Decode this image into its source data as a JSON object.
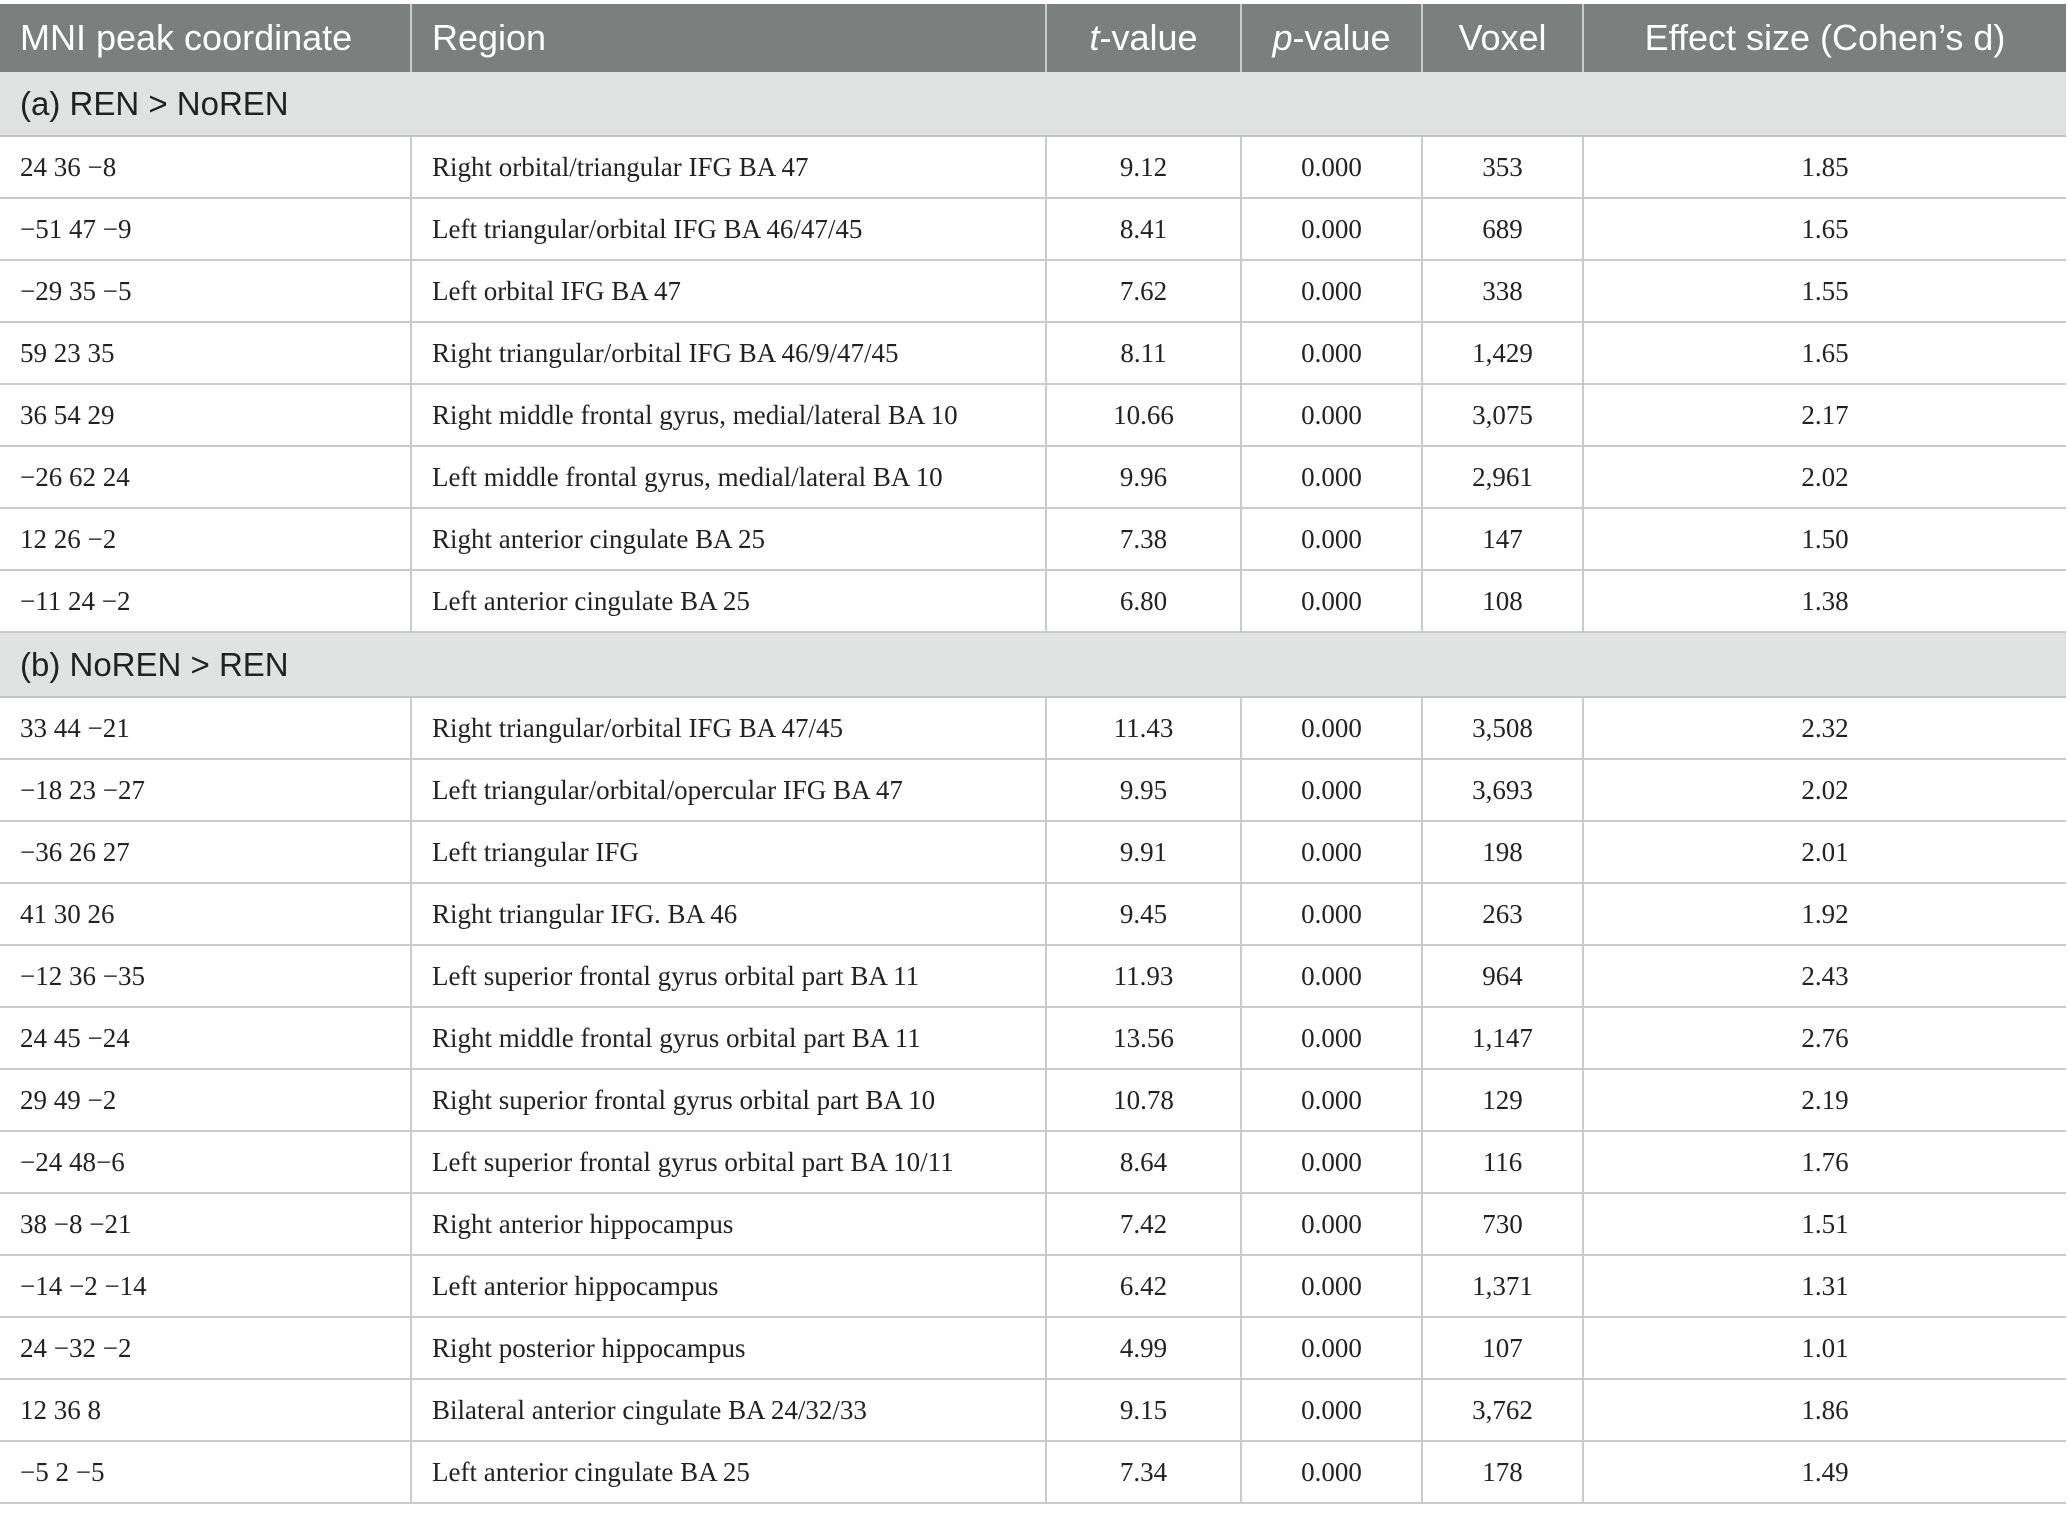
{
  "headers": {
    "mni": "MNI peak coordinate",
    "region": "Region",
    "t_italic": "t",
    "t_rest": "-value",
    "p_italic": "p",
    "p_rest": "-value",
    "voxel": "Voxel",
    "effect": "Effect size (Cohen’s d)"
  },
  "sections": [
    {
      "title": "(a) REN > NoREN",
      "rows": [
        {
          "mni": "24 36 −8",
          "region": "Right orbital/triangular IFG BA 47",
          "t": "9.12",
          "p": "0.000",
          "voxel": "353",
          "d": "1.85"
        },
        {
          "mni": "−51 47 −9",
          "region": "Left triangular/orbital IFG BA 46/47/45",
          "t": "8.41",
          "p": "0.000",
          "voxel": "689",
          "d": "1.65"
        },
        {
          "mni": "−29 35 −5",
          "region": "Left orbital IFG BA 47",
          "t": "7.62",
          "p": "0.000",
          "voxel": "338",
          "d": "1.55"
        },
        {
          "mni": "59 23 35",
          "region": "Right triangular/orbital IFG BA 46/9/47/45",
          "t": "8.11",
          "p": "0.000",
          "voxel": "1,429",
          "d": "1.65"
        },
        {
          "mni": "36 54 29",
          "region": "Right middle frontal gyrus, medial/lateral BA 10",
          "t": "10.66",
          "p": "0.000",
          "voxel": "3,075",
          "d": "2.17"
        },
        {
          "mni": "−26 62 24",
          "region": "Left middle frontal gyrus, medial/lateral BA 10",
          "t": "9.96",
          "p": "0.000",
          "voxel": "2,961",
          "d": "2.02"
        },
        {
          "mni": "12 26 −2",
          "region": "Right anterior cingulate BA 25",
          "t": "7.38",
          "p": "0.000",
          "voxel": "147",
          "d": "1.50"
        },
        {
          "mni": "−11 24 −2",
          "region": "Left anterior cingulate BA 25",
          "t": "6.80",
          "p": "0.000",
          "voxel": "108",
          "d": "1.38"
        }
      ]
    },
    {
      "title": "(b) NoREN > REN",
      "rows": [
        {
          "mni": "33 44 −21",
          "region": "Right triangular/orbital IFG BA 47/45",
          "t": "11.43",
          "p": "0.000",
          "voxel": "3,508",
          "d": "2.32"
        },
        {
          "mni": "−18 23 −27",
          "region": "Left triangular/orbital/opercular IFG BA 47",
          "t": "9.95",
          "p": "0.000",
          "voxel": "3,693",
          "d": "2.02"
        },
        {
          "mni": "−36 26 27",
          "region": "Left triangular IFG",
          "t": "9.91",
          "p": "0.000",
          "voxel": "198",
          "d": "2.01"
        },
        {
          "mni": "41 30 26",
          "region": "Right triangular IFG. BA 46",
          "t": "9.45",
          "p": "0.000",
          "voxel": "263",
          "d": "1.92"
        },
        {
          "mni": "−12 36 −35",
          "region": "Left superior frontal gyrus orbital part BA 11",
          "t": "11.93",
          "p": "0.000",
          "voxel": "964",
          "d": "2.43"
        },
        {
          "mni": "24 45 −24",
          "region": "Right middle frontal gyrus orbital part BA 11",
          "t": "13.56",
          "p": "0.000",
          "voxel": "1,147",
          "d": "2.76"
        },
        {
          "mni": "29 49 −2",
          "region": "Right superior frontal gyrus orbital part BA 10",
          "t": "10.78",
          "p": "0.000",
          "voxel": "129",
          "d": "2.19"
        },
        {
          "mni": "−24 48−6",
          "region": "Left superior frontal gyrus orbital part BA 10/11",
          "t": "8.64",
          "p": "0.000",
          "voxel": "116",
          "d": "1.76"
        },
        {
          "mni": "38 −8 −21",
          "region": "Right anterior hippocampus",
          "t": "7.42",
          "p": "0.000",
          "voxel": "730",
          "d": "1.51"
        },
        {
          "mni": "−14 −2 −14",
          "region": "Left anterior hippocampus",
          "t": "6.42",
          "p": "0.000",
          "voxel": "1,371",
          "d": "1.31"
        },
        {
          "mni": "24 −32 −2",
          "region": "Right posterior hippocampus",
          "t": "4.99",
          "p": "0.000",
          "voxel": "107",
          "d": "1.01"
        },
        {
          "mni": "12 36 8",
          "region": "Bilateral anterior cingulate BA 24/32/33",
          "t": "9.15",
          "p": "0.000",
          "voxel": "3,762",
          "d": "1.86"
        },
        {
          "mni": "−5 2 −5",
          "region": "Left anterior cingulate BA 25",
          "t": "7.34",
          "p": "0.000",
          "voxel": "178",
          "d": "1.49"
        }
      ]
    }
  ]
}
